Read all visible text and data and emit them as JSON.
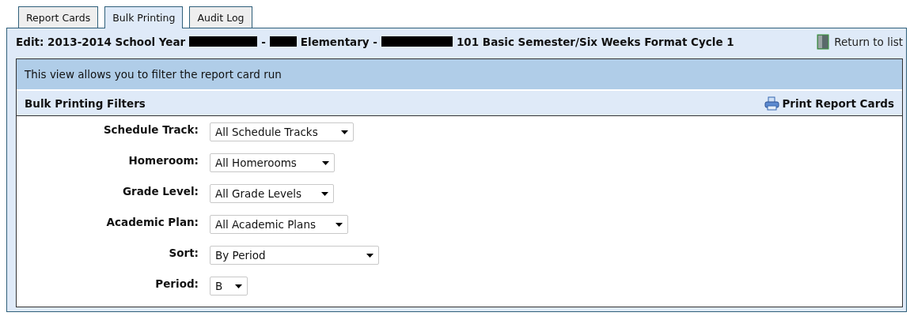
{
  "tabs": [
    {
      "label": "Report Cards",
      "selected": false
    },
    {
      "label": "Bulk Printing",
      "selected": true
    },
    {
      "label": "Audit Log",
      "selected": false
    }
  ],
  "header": {
    "title_parts": [
      {
        "kind": "text",
        "text": "Edit: 2013-2014 School Year"
      },
      {
        "kind": "redacted"
      },
      {
        "kind": "text",
        "text": "-"
      },
      {
        "kind": "redacted"
      },
      {
        "kind": "text",
        "text": "Elementary -"
      },
      {
        "kind": "redacted"
      },
      {
        "kind": "text",
        "text": "101 Basic Semester/Six Weeks Format Cycle 1"
      }
    ],
    "return_link": "Return to list"
  },
  "info": "This view allows you to filter the report card run",
  "filters": {
    "title": "Bulk Printing Filters",
    "print_button": "Print Report Cards",
    "fields": [
      {
        "label": "Schedule Track:",
        "value": "All Schedule Tracks"
      },
      {
        "label": "Homeroom:",
        "value": "All Homerooms"
      },
      {
        "label": "Grade Level:",
        "value": "All Grade Levels"
      },
      {
        "label": "Academic Plan:",
        "value": "All Academic Plans"
      },
      {
        "label": "Sort:",
        "value": "By Period"
      },
      {
        "label": "Period:",
        "value": "B"
      }
    ]
  }
}
